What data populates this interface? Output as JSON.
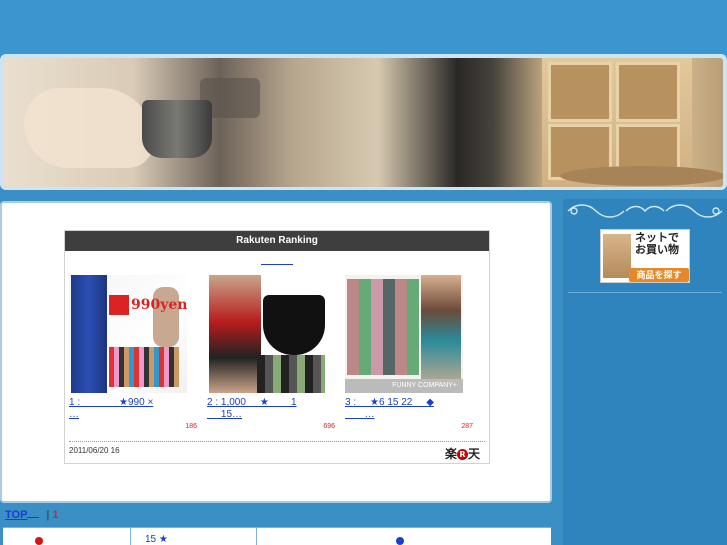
{
  "widget": {
    "title": "Rakuten Ranking",
    "date": "2011/06/20 16",
    "logo": "楽天",
    "logo_mark": "R",
    "items": [
      {
        "caption": "1 :              ★990 ×\n…",
        "count": "186",
        "image_text": "990yen"
      },
      {
        "caption": "2 : 1,000     ★        1\n     15…",
        "count": "696",
        "image_text": ""
      },
      {
        "caption": "3 :     ★6 15 22     ◆\n       …",
        "count": "287",
        "image_text": "FUNNY COMPANY+"
      }
    ]
  },
  "breadcrumb": {
    "top": "TOP",
    "separator": "|",
    "page": "1"
  },
  "table": {
    "col2_text": "15     ★",
    "colors": {
      "red_dot": "#dd1111",
      "blue_dot": "#1a3fd0"
    }
  },
  "sidebar": {
    "shop_banner": {
      "line1": "ネットで",
      "line2": "お買い物",
      "button": "商品を探す"
    }
  },
  "colors": {
    "page_bg": "#3a8fc4",
    "link": "#1a3fd0",
    "count": "#dd2222",
    "widget_header": "#3e3e3e"
  }
}
